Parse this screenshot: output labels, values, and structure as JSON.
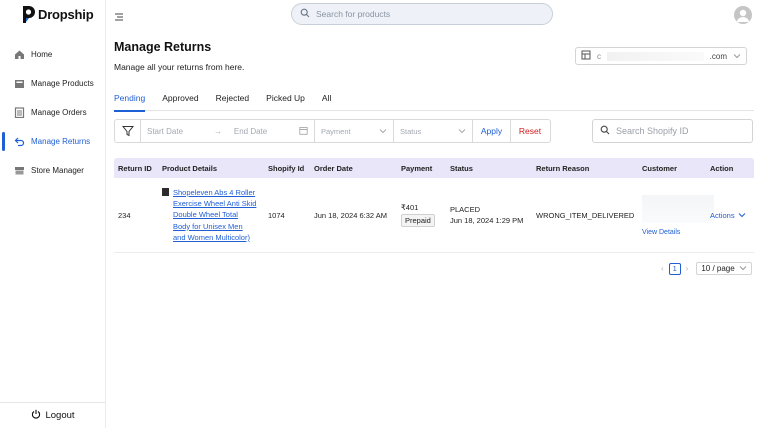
{
  "brand": {
    "name": "Dropship",
    "accent": "#1f5fd6",
    "danger": "#d11c1c"
  },
  "search": {
    "placeholder": "Search for products"
  },
  "sidebar": {
    "items": [
      {
        "label": "Home",
        "icon": "home-icon"
      },
      {
        "label": "Manage Products",
        "icon": "box-icon"
      },
      {
        "label": "Manage Orders",
        "icon": "orders-icon"
      },
      {
        "label": "Manage Returns",
        "icon": "return-icon",
        "active": true
      },
      {
        "label": "Store Manager",
        "icon": "store-icon"
      }
    ],
    "logout_label": "Logout"
  },
  "page": {
    "title": "Manage Returns",
    "subtitle": "Manage all your returns from here.",
    "store_suffix": ".com"
  },
  "tabs": [
    "Pending",
    "Approved",
    "Rejected",
    "Picked Up",
    "All"
  ],
  "filters": {
    "start_date": "Start Date",
    "end_date": "End Date",
    "payment": "Payment",
    "status": "Status",
    "apply": "Apply",
    "reset": "Reset",
    "shopify_placeholder": "Search Shopify ID"
  },
  "table": {
    "headers": [
      "Return ID",
      "Product Details",
      "Shopify Id",
      "Order Date",
      "Payment",
      "Status",
      "Return Reason",
      "Customer",
      "Action"
    ],
    "rows": [
      {
        "return_id": "234",
        "product": "Shopeleven Abs 4 Roller Exercise Wheel Anti Skid Double Wheel Total Body for Unisex Men and Women Multicolor)",
        "shopify_id": "1074",
        "order_date": "Jun 18, 2024 6:32 AM",
        "payment_amount": "₹401",
        "payment_type": "Prepaid",
        "status": "PLACED",
        "status_date": "Jun 18, 2024 1:29 PM",
        "return_reason": "WRONG_ITEM_DELIVERED",
        "view_details": "View Details",
        "actions": "Actions"
      }
    ]
  },
  "pagination": {
    "current": "1",
    "page_size": "10 / page"
  }
}
